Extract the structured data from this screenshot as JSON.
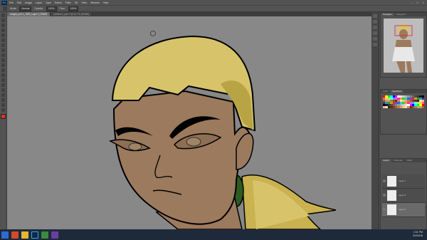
{
  "app": {
    "logo": "Ps"
  },
  "menu": [
    "File",
    "Edit",
    "Image",
    "Layer",
    "Type",
    "Select",
    "Filter",
    "3D",
    "View",
    "Window",
    "Help"
  ],
  "window_buttons": [
    "–",
    "□",
    "×"
  ],
  "options": {
    "mode_label": "Mode:",
    "mode_value": "Normal",
    "opacity_label": "Opacity:",
    "opacity_value": "100%",
    "flow_label": "Flow:",
    "flow_value": "100%"
  },
  "doc_tabs": [
    {
      "label": "tonight_part 4_1889_Layer 0_RGB/8",
      "active": true
    },
    {
      "label": "Untitled-1_part 4 @ 16.7% (RGB/8)",
      "active": false
    }
  ],
  "panels": {
    "navigator_tabs": [
      "Navigator",
      "Histogram"
    ],
    "swatches_tabs": [
      "Color",
      "Swatches"
    ],
    "layers_tabs": [
      "Layers",
      "Channels",
      "Paths"
    ],
    "layers": [
      {
        "name": "Layer 1"
      },
      {
        "name": "Layer 0"
      },
      {
        "name": "Layer 2"
      }
    ]
  },
  "swatch_colors": [
    "#ff0000",
    "#ffff00",
    "#00ff00",
    "#00ffff",
    "#0000ff",
    "#ff00ff",
    "#ffffff",
    "#e6e6e6",
    "#cccccc",
    "#b3b3b3",
    "#999999",
    "#808080",
    "#666666",
    "#4d4d4d",
    "#333333",
    "#1a1a1a",
    "#000000"
  ],
  "taskbar": {
    "time": "1:51 PM",
    "date": "3/4/2016"
  },
  "colors": {
    "skin": "#9c7a5d",
    "hair": "#d7c46a",
    "hair_shadow": "#b8a445",
    "canvas_bg": "#888888",
    "earring": "#2e5a23"
  }
}
